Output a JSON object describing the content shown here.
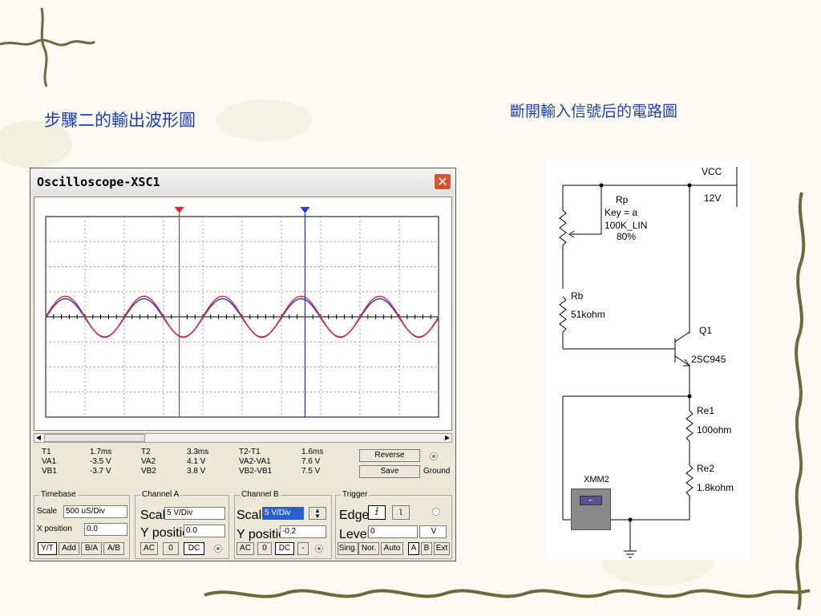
{
  "slide": {
    "title_left": "步驟二的輸出波形圖",
    "title_right": "斷開輸入信號后的電路圖"
  },
  "oscilloscope": {
    "window_title": "Oscilloscope-XSC1",
    "close_glyph": "✕",
    "cursor_colors": {
      "t1": "#e8242a",
      "t2": "#2a35e0"
    },
    "waveforms": {
      "channel_a_color": "#e8242a",
      "channel_b_color": "#2a35e0",
      "cycles_on_screen": 5,
      "channel_a_amplitude_div": 0.82,
      "channel_a_offset_div": 0.0,
      "channel_b_amplitude_div": 0.76,
      "channel_b_offset_div": -0.04
    },
    "readout": {
      "t1": {
        "label": "T1",
        "time": "1.7ms",
        "va_label": "VA1",
        "va": "-3.5 V",
        "vb_label": "VB1",
        "vb": "-3.7 V"
      },
      "t2": {
        "label": "T2",
        "time": "3.3ms",
        "va_label": "VA2",
        "va": "4.1 V",
        "vb_label": "VB2",
        "vb": "3.8 V"
      },
      "diff": {
        "label": "T2-T1",
        "time": "1.6ms",
        "va_label": "VA2-VA1",
        "va": "7.6 V",
        "vb_label": "VB2-VB1",
        "vb": "7.5 V"
      }
    },
    "buttons": {
      "reverse": "Reverse",
      "save": "Save",
      "ground": "Ground"
    },
    "timebase": {
      "title": "Timebase",
      "scale_label": "Scale",
      "scale_value": "500 uS/Div",
      "xpos_label": "X position",
      "xpos_value": "0.0",
      "modes": [
        "Y/T",
        "Add",
        "B/A",
        "A/B"
      ],
      "active_mode": "Y/T"
    },
    "channel_a": {
      "title": "Channel A",
      "scale_label": "Scale",
      "scale_value": "5 V/Div",
      "ypos_label": "Y position",
      "ypos_value": "0.0",
      "coupling": [
        "AC",
        "0",
        "DC"
      ]
    },
    "channel_b": {
      "title": "Channel B",
      "scale_label": "Scale",
      "scale_value": "5 V/Div",
      "ypos_label": "Y position",
      "ypos_value": "-0.2",
      "coupling": [
        "AC",
        "0",
        "DC",
        "-"
      ]
    },
    "trigger": {
      "title": "Trigger",
      "edge_label": "Edge",
      "level_label": "Level",
      "level_value": "0",
      "level_unit": "V",
      "modes": [
        "Sing.",
        "Nor.",
        "Auto"
      ],
      "sources": [
        "A",
        "B",
        "Ext"
      ]
    }
  },
  "schematic": {
    "vcc_label": "VCC",
    "vcc_value": "12V",
    "rp_name": "Rp",
    "rp_key": "Key = a",
    "rp_value": "100K_LIN",
    "rp_percent": "80%",
    "rb_name": "Rb",
    "rb_value": "51kohm",
    "q_name": "Q1",
    "q_part": "2SC945",
    "re1_name": "Re1",
    "re1_value": "100ohm",
    "re2_name": "Re2",
    "re2_value": "1.8kohm",
    "meter_name": "XMM2"
  }
}
